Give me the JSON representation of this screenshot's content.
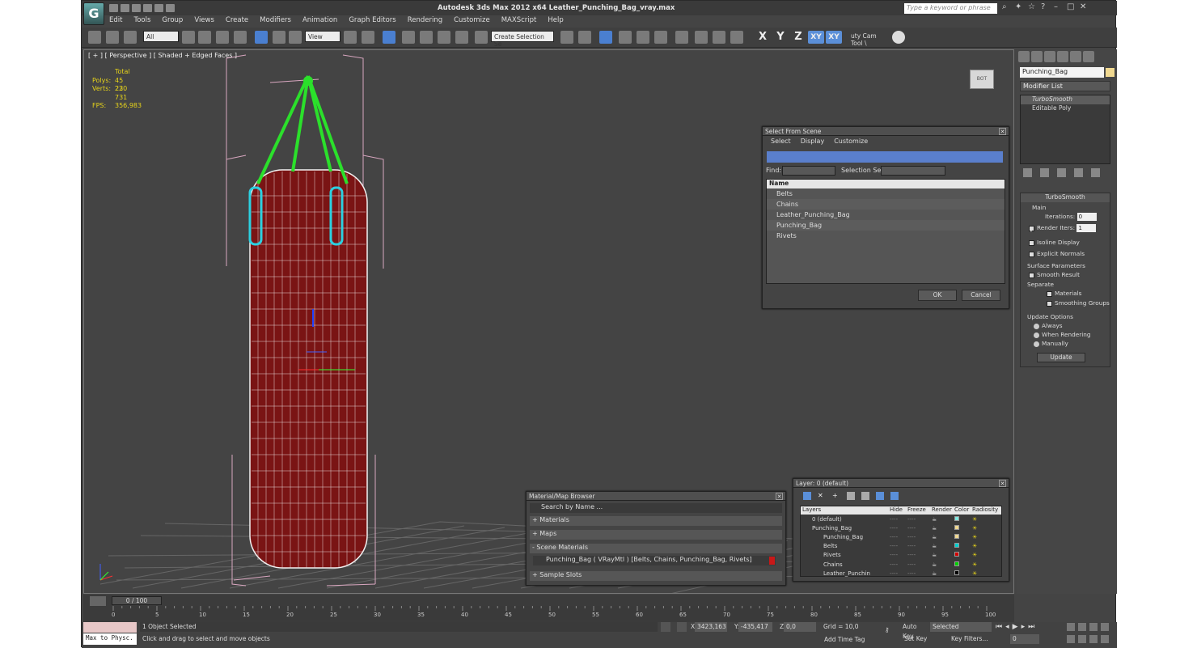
{
  "title": {
    "app": "Autodesk 3ds Max  2012 x64",
    "file": "Leather_Punching_Bag_vray.max",
    "display": "Autodesk 3ds Max  2012 x64      Leather_Punching_Bag_vray.max",
    "search_placeholder": "Type a keyword or phrase"
  },
  "menu": [
    "Edit",
    "Tools",
    "Group",
    "Views",
    "Create",
    "Modifiers",
    "Animation",
    "Graph Editors",
    "Rendering",
    "Customize",
    "MAXScript",
    "Help"
  ],
  "toolbar": {
    "filter": "All",
    "refcoord": "View",
    "selset": "Create Selection Se",
    "axes": [
      "X",
      "Y",
      "Z",
      "XY",
      "XY"
    ],
    "camtool": "uty Cam Tool \\"
  },
  "viewport": {
    "label": "[ + ] [ Perspective ] [ Shaded + Edged Faces ]",
    "stats": {
      "total": "Total",
      "polys_label": "Polys:",
      "polys": "45 230",
      "verts_label": "Verts:",
      "verts": "22 731",
      "fps_label": "FPS:",
      "fps": "356,983"
    },
    "viewcube": "BOT"
  },
  "select_from_scene": {
    "title": "Select From Scene",
    "menu": [
      "Select",
      "Display",
      "Customize"
    ],
    "find_label": "Find:",
    "selset_label": "Selection Set:",
    "column": "Name",
    "items": [
      "Belts",
      "Chains",
      "Leather_Punching_Bag",
      "Punching_Bag",
      "Rivets"
    ],
    "ok": "OK",
    "cancel": "Cancel"
  },
  "material_browser": {
    "title": "Material/Map Browser",
    "search": "Search by Name ...",
    "sections": [
      "+ Materials",
      "+ Maps",
      "- Scene Materials",
      "+ Sample Slots"
    ],
    "material": "Punching_Bag  ( VRayMtl ) [Belts, Chains, Punching_Bag, Rivets]"
  },
  "layer_dialog": {
    "title": "Layer: 0 (default)",
    "columns": [
      "Layers",
      "Hide",
      "Freeze",
      "Render",
      "Color",
      "Radiosity"
    ],
    "rows": [
      {
        "name": "0 (default)",
        "color": "#7fe8e0"
      },
      {
        "name": "Punching_Bag",
        "color": "#f0d890"
      },
      {
        "name": "Punching_Bag",
        "color": "#f0d890"
      },
      {
        "name": "Belts",
        "color": "#00d0d0"
      },
      {
        "name": "Rivets",
        "color": "#d00000"
      },
      {
        "name": "Chains",
        "color": "#00d000"
      },
      {
        "name": "Leather_Punchin",
        "color": "#000000"
      }
    ]
  },
  "command_panel": {
    "object_name": "Punching_Bag",
    "modifier_list": "Modifier List",
    "stack": [
      "TurboSmooth",
      "Editable Poly"
    ],
    "rollout": "TurboSmooth",
    "main": "Main",
    "iterations_label": "Iterations:",
    "iterations": "0",
    "render_iters_label": "Render Iters:",
    "render_iters": "1",
    "isoline": "Isoline Display",
    "explicit": "Explicit Normals",
    "surface": "Surface Parameters",
    "smooth_result": "Smooth Result",
    "separate": "Separate",
    "materials": "Materials",
    "smoothing": "Smoothing Groups",
    "update_options": "Update Options",
    "always": "Always",
    "when_rendering": "When Rendering",
    "manually": "Manually",
    "update": "Update"
  },
  "timeline": {
    "slider": "0 / 100",
    "ticks": [
      "0",
      "5",
      "10",
      "15",
      "20",
      "25",
      "30",
      "35",
      "40",
      "45",
      "50",
      "55",
      "60",
      "65",
      "70",
      "75",
      "80",
      "85",
      "90",
      "95",
      "100"
    ]
  },
  "status": {
    "listener": "Max to Physc.",
    "selected": "1 Object Selected",
    "prompt": "Click and drag to select and move objects",
    "x_label": "X:",
    "x": "3423,163",
    "y_label": "Y:",
    "y": "-435,417",
    "z_label": "Z:",
    "z": "0,0",
    "grid": "Grid = 10,0",
    "autokey": "Auto Key",
    "setkey": "Set Key",
    "selected_dd": "Selected",
    "keyfilters": "Key Filters...",
    "addtimetag": "Add Time Tag",
    "frame": "0"
  }
}
